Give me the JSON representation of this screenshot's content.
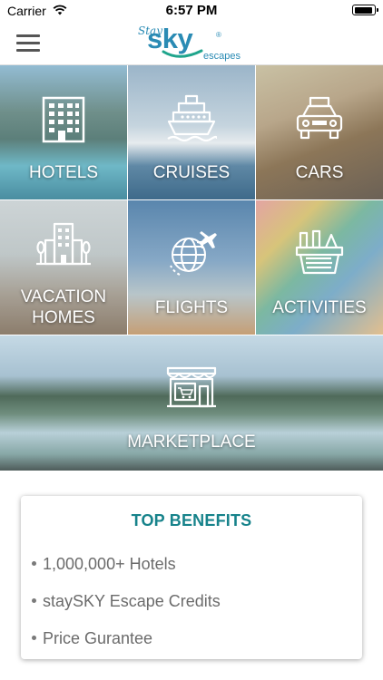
{
  "status_bar": {
    "carrier": "Carrier",
    "time": "6:57 PM",
    "battery_level": 0.95
  },
  "header": {
    "logo": {
      "stay": "Stay",
      "sky": "sky",
      "registered": "®",
      "escapes": "escapes"
    },
    "menu_icon": "hamburger-menu-icon"
  },
  "categories": [
    {
      "label": "HOTELS",
      "icon": "hotel-building-icon"
    },
    {
      "label": "CRUISES",
      "icon": "cruise-ship-icon"
    },
    {
      "label": "CARS",
      "icon": "taxi-icon"
    },
    {
      "label_line1": "VACATION",
      "label_line2": "HOMES",
      "icon": "vacation-home-icon"
    },
    {
      "label": "FLIGHTS",
      "icon": "globe-plane-icon"
    },
    {
      "label": "ACTIVITIES",
      "icon": "picnic-basket-icon"
    },
    {
      "label": "MARKETPLACE",
      "icon": "storefront-icon"
    }
  ],
  "benefits": {
    "title": "TOP BENEFITS",
    "items": [
      "1,000,000+ Hotels",
      "staySKY Escape Credits",
      "Price Gurantee"
    ]
  },
  "colors": {
    "brand": "#2a8bb4",
    "benefits_title": "#17838b",
    "text_gray": "#6b6b6b"
  }
}
